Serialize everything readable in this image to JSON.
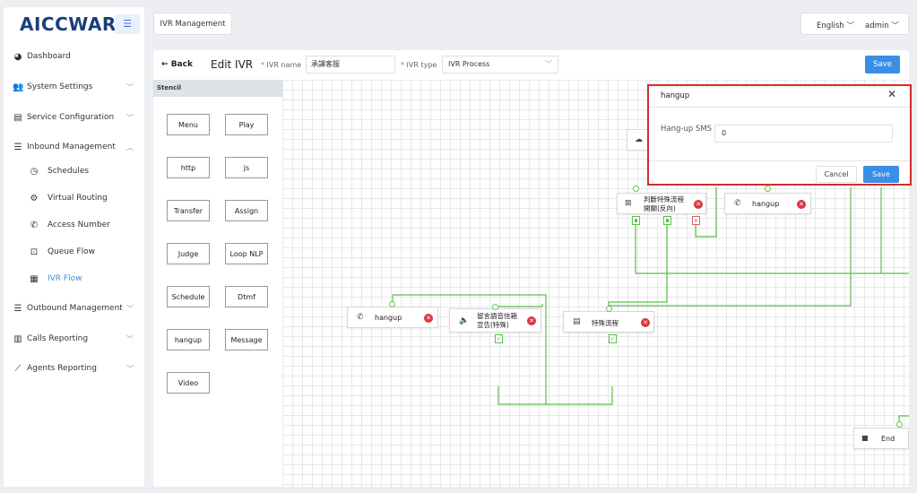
{
  "brand": {
    "logo": "AICCWARE"
  },
  "sidebar": {
    "items": [
      {
        "label": "Dashboard",
        "icon": "dashboard-icon"
      },
      {
        "label": "System Settings",
        "icon": "users-icon"
      },
      {
        "label": "Service Configuration",
        "icon": "id-card-icon"
      },
      {
        "label": "Inbound Management",
        "icon": "list-icon",
        "expanded": true
      },
      {
        "label": "Outbound Management",
        "icon": "list-icon"
      },
      {
        "label": "Calls Reporting",
        "icon": "bar-chart-icon"
      },
      {
        "label": "Agents Reporting",
        "icon": "line-chart-icon"
      }
    ],
    "subitems": [
      {
        "label": "Schedules",
        "icon": "clock-icon"
      },
      {
        "label": "Virtual Routing",
        "icon": "gear-icon"
      },
      {
        "label": "Access Number",
        "icon": "phone-icon"
      },
      {
        "label": "Queue Flow",
        "icon": "inbox-icon"
      },
      {
        "label": "IVR Flow",
        "icon": "film-icon",
        "active": true
      }
    ]
  },
  "header": {
    "tab": "IVR Management",
    "language": "English",
    "user": "admin"
  },
  "editor": {
    "back": "Back",
    "title": "Edit IVR",
    "name_label": "IVR name",
    "name_value": "承譯客服",
    "type_label": "IVR type",
    "type_value": "IVR Process",
    "save": "Save"
  },
  "stencil": {
    "title": "Stencil",
    "items": [
      "Menu",
      "Play",
      "http",
      "js",
      "Transfer",
      "Assign",
      "Judge",
      "Loop NLP",
      "Schedule",
      "Dtmf",
      "hangup",
      "Message",
      "Video"
    ]
  },
  "nodes": {
    "judge": {
      "label_line1": "判斷特殊流程",
      "label_line2": "開關(反向)"
    },
    "hangup_top": {
      "label": "hangup"
    },
    "hangup_left": {
      "label": "hangup"
    },
    "voicemail": {
      "label_line1": "留言語音信箱",
      "label_line2": "宣告(特殊)"
    },
    "special": {
      "label": "特殊流程"
    },
    "end": {
      "label": "End"
    }
  },
  "dialog": {
    "title": "hangup",
    "field_label": "Hang-up SMS",
    "field_value": "0",
    "cancel": "Cancel",
    "save": "Save",
    "highlight_color": "#d62b2b"
  },
  "colors": {
    "accent": "#3a8ee6",
    "wire": "#5bbf4a",
    "delete": "#d9363e"
  }
}
